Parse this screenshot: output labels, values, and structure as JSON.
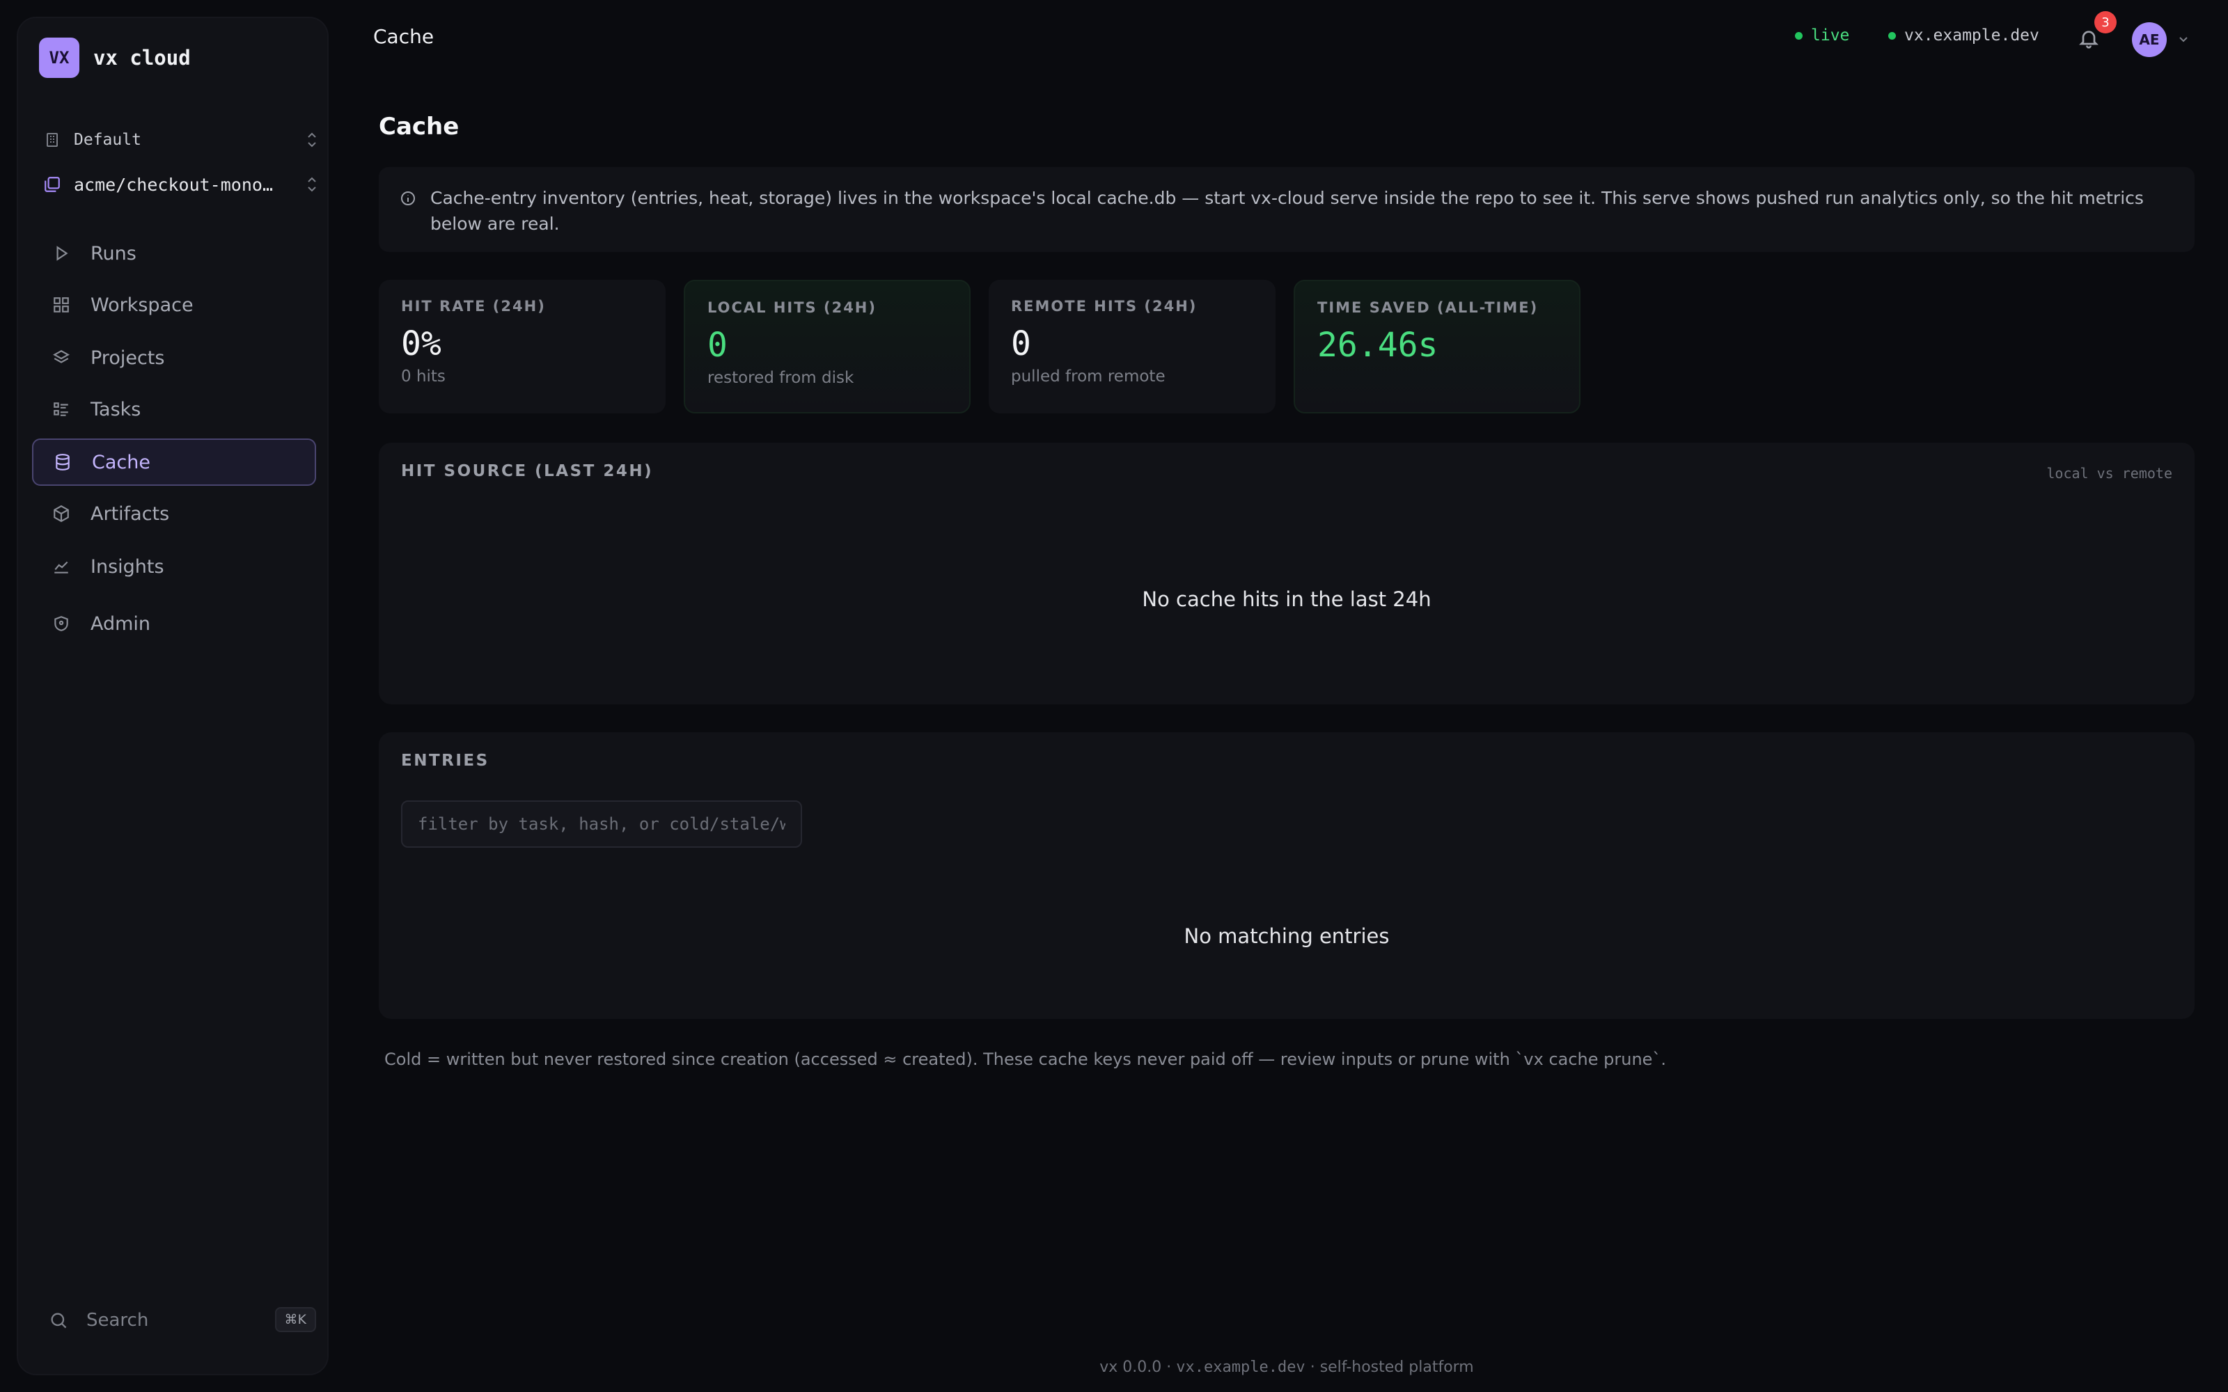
{
  "sidebar": {
    "brand_logo": "VX",
    "brand_name": "vx cloud",
    "org": "Default",
    "repo": "acme/checkout-monorepo",
    "items": [
      {
        "label": "Runs",
        "icon": "play-icon"
      },
      {
        "label": "Workspace",
        "icon": "grid-icon"
      },
      {
        "label": "Projects",
        "icon": "layers-icon"
      },
      {
        "label": "Tasks",
        "icon": "list-icon"
      },
      {
        "label": "Cache",
        "icon": "database-icon",
        "active": true
      },
      {
        "label": "Artifacts",
        "icon": "box-icon"
      },
      {
        "label": "Insights",
        "icon": "chart-icon"
      },
      {
        "label": "Admin",
        "icon": "shield-icon"
      }
    ],
    "search_label": "Search",
    "search_shortcut": "⌘K"
  },
  "topbar": {
    "title": "Cache",
    "live_label": "live",
    "host": "vx.example.dev",
    "notifications_count": "3",
    "avatar_initials": "AE"
  },
  "main": {
    "title": "Cache",
    "info_text": "Cache-entry inventory (entries, heat, storage) lives in the workspace's local cache.db — start vx-cloud serve inside the repo to see it. This serve shows pushed run analytics only, so the hit metrics below are real.",
    "stats": [
      {
        "label": "HIT RATE (24H)",
        "value": "0%",
        "sub": "0 hits"
      },
      {
        "label": "LOCAL HITS (24H)",
        "value": "0",
        "sub": "restored from disk"
      },
      {
        "label": "REMOTE HITS (24H)",
        "value": "0",
        "sub": "pulled from remote"
      },
      {
        "label": "TIME SAVED (ALL-TIME)",
        "value": "26.46s",
        "sub": ""
      }
    ],
    "hit_source": {
      "title": "HIT SOURCE (LAST 24H)",
      "aside": "local vs remote",
      "empty": "No cache hits in the last 24h"
    },
    "entries": {
      "title": "ENTRIES",
      "filter_placeholder": "filter by task, hash, or cold/stale/warm",
      "filter_value": "",
      "empty": "No matching entries"
    },
    "footnote": "Cold = written but never restored since creation (accessed ≈ created). These cache keys never paid off — review inputs or prune with `vx cache prune`."
  },
  "footer": {
    "version": "vx 0.0.0",
    "host": "vx.example.dev",
    "tagline": "self-hosted platform"
  },
  "colors": {
    "accent": "#a78bfa",
    "success": "#4ade80",
    "background": "#0a0b0f",
    "panel": "#111217",
    "badge": "#ef4444"
  }
}
